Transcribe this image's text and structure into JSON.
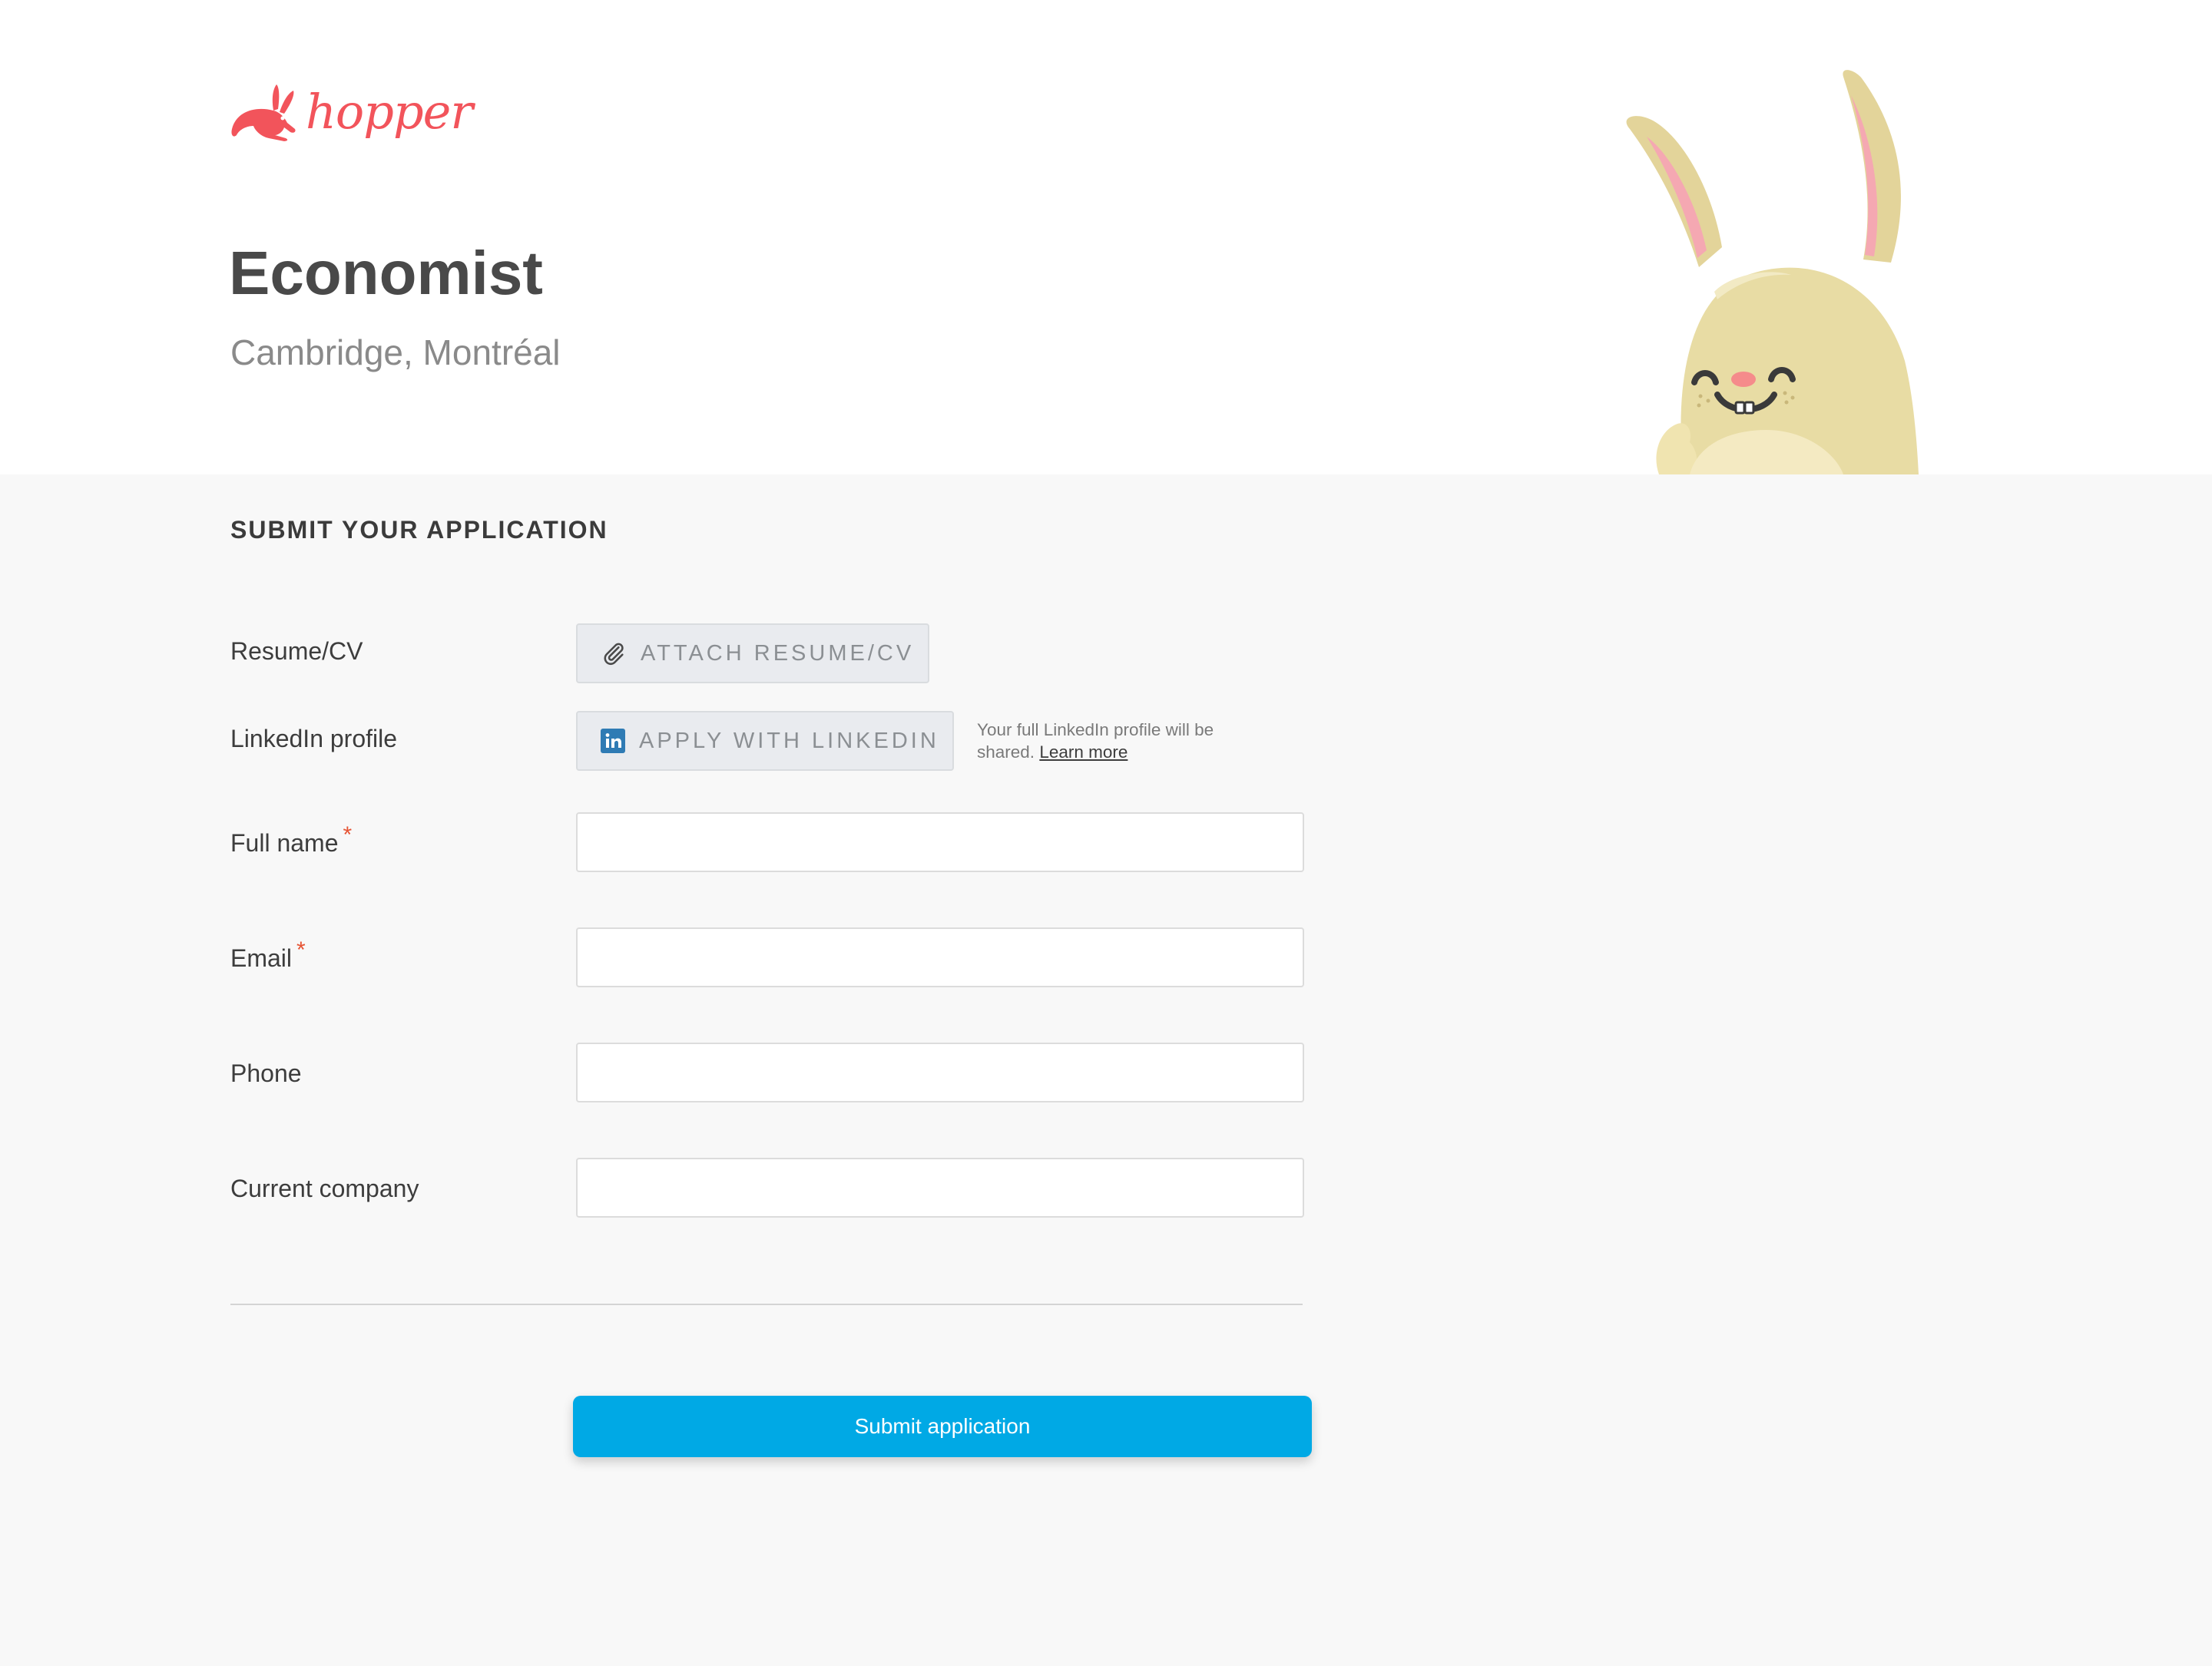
{
  "brand": {
    "name": "hopper",
    "color": "#f2545b"
  },
  "job": {
    "title": "Economist",
    "location": "Cambridge, Montréal"
  },
  "form": {
    "section_title": "SUBMIT YOUR APPLICATION",
    "resume": {
      "label": "Resume/CV",
      "button": "ATTACH RESUME/CV",
      "icon": "paperclip-icon"
    },
    "linkedin": {
      "label": "LinkedIn profile",
      "button": "APPLY WITH LINKEDIN",
      "icon": "linkedin-icon",
      "note": "Your full LinkedIn profile will be shared.",
      "note_link": "Learn more"
    },
    "fields": {
      "full_name": {
        "label": "Full name",
        "required_mark": "*",
        "value": "",
        "placeholder": ""
      },
      "email": {
        "label": "Email",
        "required_mark": "*",
        "value": "",
        "placeholder": ""
      },
      "phone": {
        "label": "Phone",
        "value": "",
        "placeholder": ""
      },
      "current_company": {
        "label": "Current company",
        "value": "",
        "placeholder": ""
      }
    },
    "submit_label": "Submit application"
  },
  "colors": {
    "accent": "#00a9e5",
    "required": "#e65333",
    "background": "#f8f8f8",
    "header_background": "#ffffff"
  }
}
